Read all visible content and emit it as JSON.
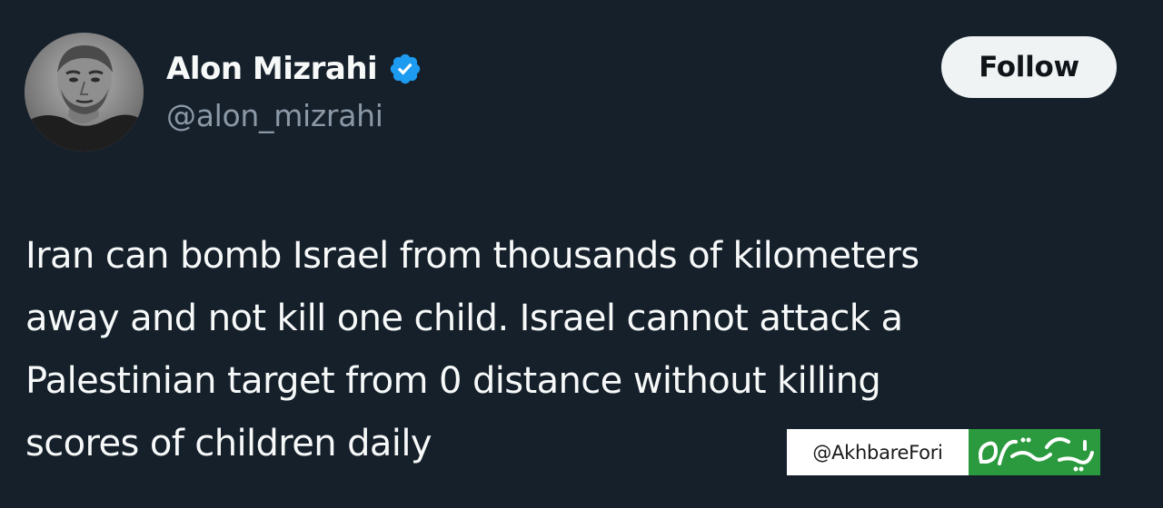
{
  "author": {
    "display_name": "Alon Mizrahi",
    "handle": "@alon_mizrahi",
    "verified": true,
    "verified_icon": "verified-badge-icon"
  },
  "actions": {
    "follow_label": "Follow"
  },
  "tweet": {
    "text": "Iran can bomb Israel from thousands of kilometers\naway and not kill one child. Israel cannot attack a\nPalestinian target from 0 distance without killing\nscores of children daily"
  },
  "watermark": {
    "handle": "@AkhbareFori",
    "logo_text": "خبر فوری"
  },
  "colors": {
    "background": "#15202b",
    "primary_text": "#f7f9f9",
    "secondary_text": "#8b98a5",
    "verified_blue": "#1d9bf0",
    "follow_button_bg": "#eff3f4",
    "watermark_green": "#2b9a3e"
  }
}
